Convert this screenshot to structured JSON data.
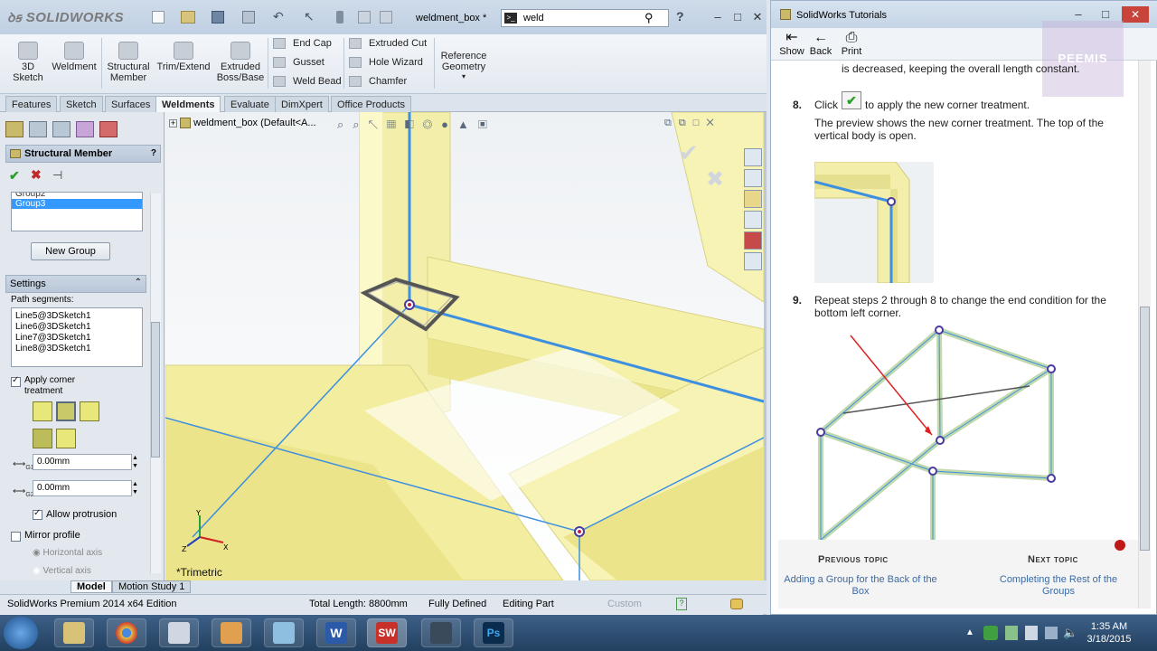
{
  "solidworks": {
    "brand": "SOLIDWORKS",
    "doc_title": "weldment_box *",
    "search_value": "weld",
    "commands": {
      "sketch3d": "3D\nSketch",
      "weldment": "Weldment",
      "structural_member": "Structural\nMember",
      "trim_extend": "Trim/Extend",
      "extruded_boss": "Extruded\nBoss/Base",
      "end_cap": "End Cap",
      "gusset": "Gusset",
      "weld_bead": "Weld Bead",
      "extruded_cut": "Extruded Cut",
      "hole_wizard": "Hole Wizard",
      "chamfer": "Chamfer",
      "reference_geometry": "Reference\nGeometry"
    },
    "tabs": [
      "Features",
      "Sketch",
      "Surfaces",
      "Weldments",
      "Evaluate",
      "DimXpert",
      "Office Products"
    ],
    "active_tab": "Weldments",
    "property_manager": {
      "title": "Structural Member",
      "groups": [
        "Group2",
        "Group3"
      ],
      "selected_group": "Group3",
      "new_group": "New Group",
      "settings_title": "Settings",
      "path_segments_label": "Path segments:",
      "path_segments": [
        "Line5@3DSketch1",
        "Line6@3DSketch1",
        "Line7@3DSketch1",
        "Line8@3DSketch1"
      ],
      "apply_corner": "Apply corner\ntreatment",
      "g1_value": "0.00mm",
      "g2_value": "0.00mm",
      "g1_label": "G1",
      "g2_label": "G2",
      "allow_protrusion": "Allow protrusion",
      "mirror_profile": "Mirror profile",
      "horizontal_axis": "Horizontal axis",
      "vertical_axis": "Vertical axis"
    },
    "tree_label": "weldment_box  (Default<A...",
    "view_label": "*Trimetric",
    "bottom_tabs": [
      "Model",
      "Motion Study 1"
    ],
    "status": {
      "edition": "SolidWorks Premium 2014 x64 Edition",
      "length": "Total Length: 8800mm",
      "defined": "Fully Defined",
      "mode": "Editing Part",
      "custom": "Custom"
    }
  },
  "tutorial": {
    "title": "SolidWorks Tutorials",
    "toolbar": [
      "Show",
      "Back",
      "Print"
    ],
    "watermark": "PEEMIS",
    "partial_text": "is decreased, keeping the overall length constant.",
    "step8_num": "8.",
    "step8_click": "Click",
    "step8_rest": "to apply the new corner treatment.",
    "step8_desc": "The preview shows the new corner treatment. The top of the vertical body is open.",
    "step9_num": "9.",
    "step9_text": "Repeat steps 2 through 8 to change the end condition for the bottom left corner.",
    "prev_head": "Previous topic",
    "prev_link": "Adding a Group for the Back of the Box",
    "next_head": "Next topic",
    "next_link": "Completing the Rest of the Groups"
  },
  "taskbar": {
    "time": "1:35 AM",
    "date": "3/18/2015"
  }
}
